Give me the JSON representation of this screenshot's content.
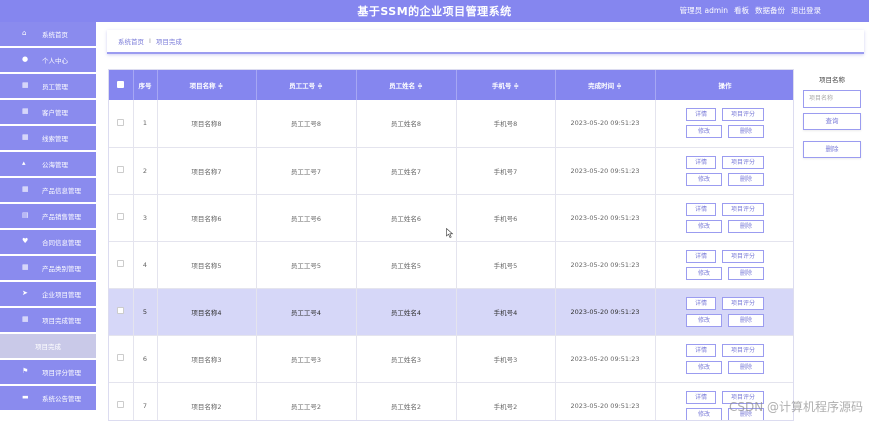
{
  "header": {
    "title": "基于SSM的企业项目管理系统",
    "nav": [
      "管理员 admin",
      "看板",
      "数据备份",
      "退出登录"
    ]
  },
  "sidebar": {
    "items": [
      {
        "label": "系统首页",
        "icon": "home-icon",
        "glyph": "⌂"
      },
      {
        "label": "个人中心",
        "icon": "user-icon",
        "glyph": "●"
      },
      {
        "label": "员工管理",
        "icon": "grid-icon",
        "glyph": "▦"
      },
      {
        "label": "客户管理",
        "icon": "grid-icon",
        "glyph": "▦"
      },
      {
        "label": "线索管理",
        "icon": "grid-icon",
        "glyph": "▦"
      },
      {
        "label": "公海管理",
        "icon": "thumb-icon",
        "glyph": "▴"
      },
      {
        "label": "产品信息管理",
        "icon": "grid-icon",
        "glyph": "▦"
      },
      {
        "label": "产品销售管理",
        "icon": "clipboard-icon",
        "glyph": "▤"
      },
      {
        "label": "合同信息管理",
        "icon": "heart-icon",
        "glyph": "♥"
      },
      {
        "label": "产品类别管理",
        "icon": "grid-icon",
        "glyph": "▦"
      },
      {
        "label": "企业项目管理",
        "icon": "send-icon",
        "glyph": "➤"
      },
      {
        "label": "项目完成管理",
        "icon": "grid-icon",
        "glyph": "▦"
      }
    ],
    "sub_item": "项目完成",
    "items_after": [
      {
        "label": "项目评分管理",
        "icon": "flag-icon",
        "glyph": "⚑"
      },
      {
        "label": "系统公告管理",
        "icon": "briefcase-icon",
        "glyph": "▬"
      }
    ]
  },
  "breadcrumb": {
    "home": "系统首页",
    "separator": "I",
    "current": "项目完成"
  },
  "table": {
    "headers": [
      "序号",
      "项目名称 ≑",
      "员工工号 ≑",
      "员工姓名 ≑",
      "手机号 ≑",
      "完成时间 ≑",
      "操作"
    ],
    "rows": [
      {
        "idx": "1",
        "name": "项目名称8",
        "no": "员工工号8",
        "staff": "员工姓名8",
        "phone": "手机号8",
        "time": "2023-05-20 09:51:23",
        "hl": false
      },
      {
        "idx": "2",
        "name": "项目名称7",
        "no": "员工工号7",
        "staff": "员工姓名7",
        "phone": "手机号7",
        "time": "2023-05-20 09:51:23",
        "hl": false
      },
      {
        "idx": "3",
        "name": "项目名称6",
        "no": "员工工号6",
        "staff": "员工姓名6",
        "phone": "手机号6",
        "time": "2023-05-20 09:51:23",
        "hl": false
      },
      {
        "idx": "4",
        "name": "项目名称5",
        "no": "员工工号5",
        "staff": "员工姓名5",
        "phone": "手机号5",
        "time": "2023-05-20 09:51:23",
        "hl": false
      },
      {
        "idx": "5",
        "name": "项目名称4",
        "no": "员工工号4",
        "staff": "员工姓名4",
        "phone": "手机号4",
        "time": "2023-05-20 09:51:23",
        "hl": true
      },
      {
        "idx": "6",
        "name": "项目名称3",
        "no": "员工工号3",
        "staff": "员工姓名3",
        "phone": "手机号3",
        "time": "2023-05-20 09:51:23",
        "hl": false
      },
      {
        "idx": "7",
        "name": "项目名称2",
        "no": "员工工号2",
        "staff": "员工姓名2",
        "phone": "手机号2",
        "time": "2023-05-20 09:51:23",
        "hl": false
      }
    ],
    "actions": {
      "detail": "详情",
      "score": "项目评分",
      "edit": "修改",
      "delete": "删除"
    }
  },
  "search": {
    "label": "项目名称",
    "placeholder": "项目名称",
    "query_button": "查询",
    "delete_button": "删除"
  },
  "watermark": "CSDN @计算机程序源码",
  "colors": {
    "accent": "#8586ef",
    "highlight_row": "#d6d7f8"
  }
}
